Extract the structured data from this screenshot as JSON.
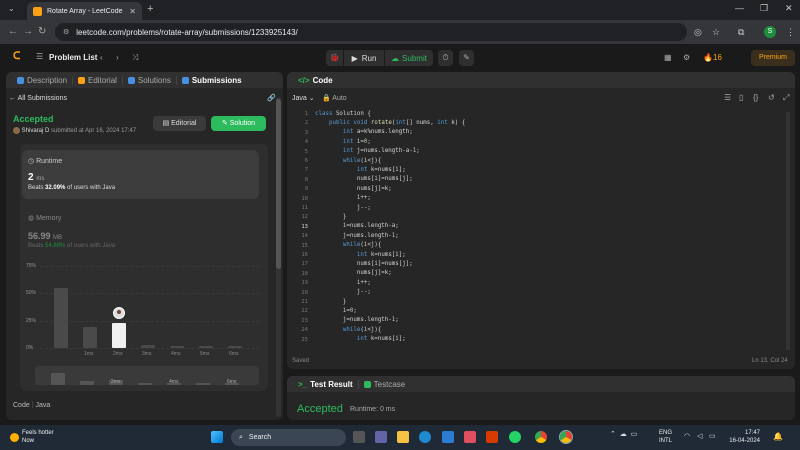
{
  "browser": {
    "tab_title": "Rotate Array - LeetCode",
    "url": "leetcode.com/problems/rotate-array/submissions/1233925143/",
    "profile_initial": "S"
  },
  "header": {
    "problem_list": "Problem List",
    "run": "Run",
    "submit": "Submit",
    "streak": "16",
    "premium": "Premium"
  },
  "left_panel": {
    "tabs": [
      "Description",
      "Editorial",
      "Solutions",
      "Submissions"
    ],
    "all_submissions": "All Submissions",
    "status": "Accepted",
    "author": "Shivaraj D",
    "submitted_text": "submitted at Apr 16, 2024 17:47",
    "editorial_btn": "Editorial",
    "solution_btn": "Solution",
    "runtime": {
      "label": "Runtime",
      "value": "2",
      "unit": "ms",
      "beats_prefix": "Beats",
      "beats_pct": "32.09%",
      "beats_suffix": "of users with Java"
    },
    "memory": {
      "label": "Memory",
      "value": "56.99",
      "unit": "MB",
      "beats_prefix": "Beats",
      "beats_pct": "54.88%",
      "beats_suffix": "of users with Java"
    },
    "code_label": "Code",
    "code_lang": "Java"
  },
  "chart_data": {
    "type": "bar",
    "categories": [
      "",
      "1ms",
      "2ms",
      "3ms",
      "4ms",
      "5ms",
      "6ms"
    ],
    "values": [
      55,
      19,
      23,
      3,
      2,
      2,
      2
    ],
    "y_ticks": [
      "75%",
      "50%",
      "25%",
      "0%"
    ],
    "ylim": [
      0,
      75
    ],
    "highlight_index": 2,
    "mini_ticks": [
      "2ms",
      "4ms",
      "6ms"
    ],
    "grid": true
  },
  "editor": {
    "title": "Code",
    "language": "Java",
    "mode": "Auto",
    "lines": [
      "class Solution {",
      "    public void rotate(int[] nums, int k) {",
      "        int a=k%nums.length;",
      "        int i=0;",
      "        int j=nums.length-a-1;",
      "        while(i<j){",
      "            int k=nums[i];",
      "            nums[i]=nums[j];",
      "            nums[j]=k;",
      "            i++;",
      "            j--;",
      "        }",
      "        i=nums.length-a;",
      "        j=nums.length-1;",
      "        while(i<j){",
      "            int k=nums[i];",
      "            nums[i]=nums[j];",
      "            nums[j]=k;",
      "            i++;",
      "            j--;",
      "        }",
      "        i=0;",
      "        j=nums.length-1;",
      "        while(i<j){",
      "            int k=nums[i];"
    ],
    "saved": "Saved",
    "cursor": "Ln 13, Col 24"
  },
  "result_panel": {
    "tabs": [
      "Test Result",
      "Testcase"
    ],
    "status": "Accepted",
    "runtime": "Runtime: 0 ms"
  },
  "taskbar": {
    "weather_line1": "Feels hotter",
    "weather_line2": "Now",
    "search": "Search",
    "lang_line1": "ENG",
    "lang_line2": "INTL",
    "time": "17:47",
    "date": "16-04-2024"
  }
}
